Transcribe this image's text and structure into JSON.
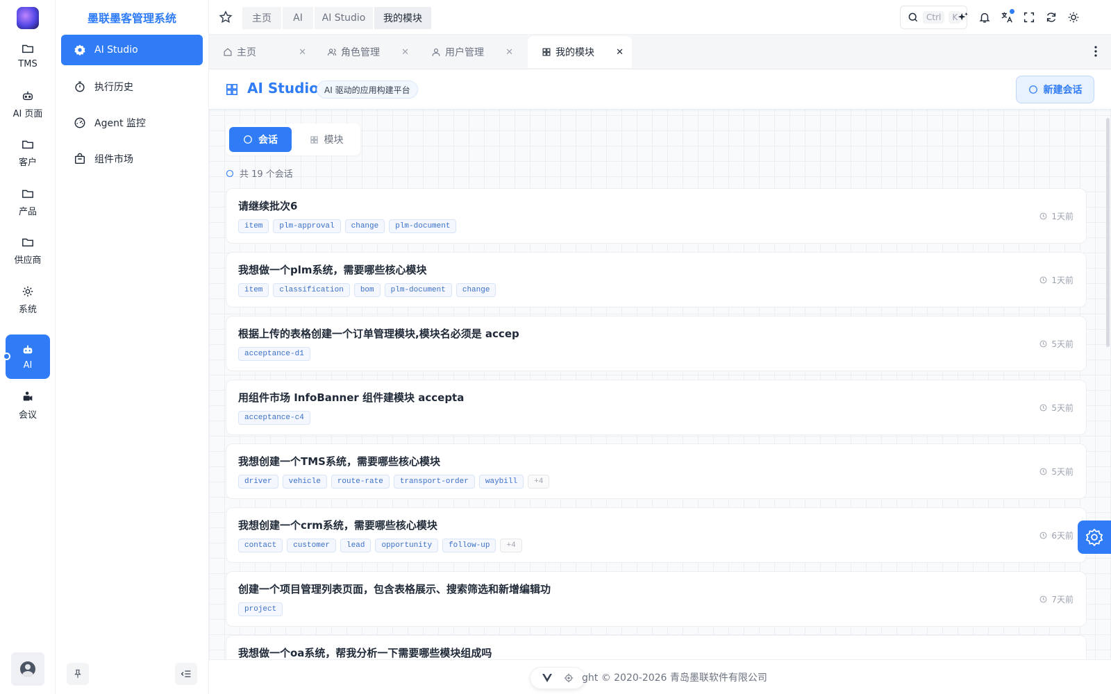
{
  "rail": {
    "items": [
      {
        "label": "TMS",
        "icon": "folder-icon"
      },
      {
        "label": "AI 页面",
        "icon": "robot-icon"
      },
      {
        "label": "客户",
        "icon": "folder-icon"
      },
      {
        "label": "产品",
        "icon": "folder-icon"
      },
      {
        "label": "供应商",
        "icon": "folder-icon"
      },
      {
        "label": "系统",
        "icon": "gear-icon"
      },
      {
        "label": "AI",
        "icon": "robot-icon",
        "active": true
      },
      {
        "label": "会议",
        "icon": "video-camera-icon"
      }
    ]
  },
  "sidebar": {
    "title": "墨联墨客管理系统",
    "items": [
      {
        "label": "AI Studio",
        "icon": "gear-icon",
        "active": true
      },
      {
        "label": "执行历史",
        "icon": "stopwatch-icon"
      },
      {
        "label": "Agent 监控",
        "icon": "gauge-icon"
      },
      {
        "label": "组件市场",
        "icon": "shopping-bag-icon"
      }
    ]
  },
  "header": {
    "breadcrumbs": [
      "主页",
      "AI",
      "AI Studio",
      "我的模块"
    ],
    "search": {
      "kbd1": "Ctrl",
      "kbd2": "K"
    }
  },
  "tabs": [
    {
      "label": "主页",
      "icon": "home-icon"
    },
    {
      "label": "角色管理",
      "icon": "user-group-icon"
    },
    {
      "label": "用户管理",
      "icon": "user-icon"
    },
    {
      "label": "我的模块",
      "icon": "grid-icon",
      "active": true
    }
  ],
  "page": {
    "title": "AI Studio",
    "subtitle": "AI 驱动的应用构建平台",
    "new_button": "新建会话",
    "segments": {
      "conversations": "会话",
      "modules": "模块"
    },
    "count_text": "共 19 个会话"
  },
  "sessions": [
    {
      "title": "请继续批次6",
      "tags": [
        "item",
        "plm-approval",
        "change",
        "plm-document"
      ],
      "time": "1天前"
    },
    {
      "title": "我想做一个plm系统，需要哪些核心模块",
      "tags": [
        "item",
        "classification",
        "bom",
        "plm-document",
        "change"
      ],
      "time": "1天前"
    },
    {
      "title": "根据上传的表格创建一个订单管理模块,模块名必须是 accep",
      "tags": [
        "acceptance-d1"
      ],
      "time": "5天前"
    },
    {
      "title": "用组件市场 InfoBanner 组件建模块 accepta",
      "tags": [
        "acceptance-c4"
      ],
      "time": "5天前"
    },
    {
      "title": "我想创建一个TMS系统，需要哪些核心模块",
      "tags": [
        "driver",
        "vehicle",
        "route-rate",
        "transport-order",
        "waybill",
        "+4"
      ],
      "time": "5天前"
    },
    {
      "title": "我想创建一个crm系统，需要哪些核心模块",
      "tags": [
        "contact",
        "customer",
        "lead",
        "opportunity",
        "follow-up",
        "+4"
      ],
      "time": "6天前"
    },
    {
      "title": "创建一个项目管理列表页面，包含表格展示、搜索筛选和新增编辑功",
      "tags": [
        "project"
      ],
      "time": "7天前"
    },
    {
      "title": "我想做一个oa系统，帮我分析一下需要哪些模块组成吗",
      "tags": [],
      "time": ""
    }
  ],
  "footer": {
    "copyright": "ght © 2020-2026  青岛墨联软件有限公司"
  },
  "colors": {
    "accent": "#2f7cf6",
    "text": "#1f2937",
    "muted": "#9ca3af"
  }
}
